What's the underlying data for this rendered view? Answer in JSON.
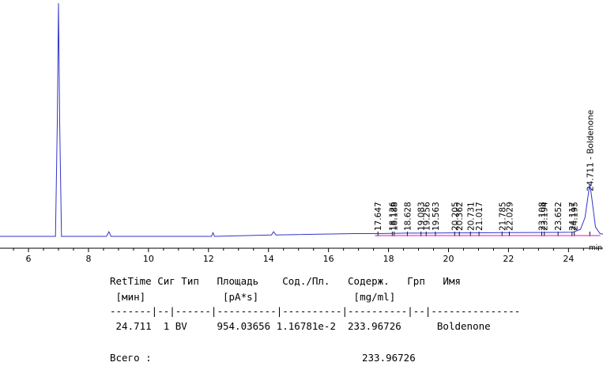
{
  "chart_data": {
    "type": "line",
    "x_unit_label": "min",
    "x_ticks": [
      6,
      8,
      10,
      12,
      14,
      16,
      18,
      20,
      22,
      24
    ],
    "xlim": [
      5.05,
      25.15
    ],
    "ylim": [
      0,
      1000
    ],
    "grid": false,
    "series": [
      {
        "color": "#3333cc",
        "x": [
          5.05,
          6.0,
          6.9,
          6.96,
          7.0,
          7.04,
          7.1,
          8.6,
          8.68,
          8.75,
          10.0,
          12.1,
          12.15,
          12.2,
          14.1,
          14.17,
          14.25,
          16.9,
          17.65,
          18.63,
          19.26,
          20.03,
          20.73,
          21.79,
          22.03,
          23.65,
          24.15,
          24.4,
          24.55,
          24.65,
          24.711,
          24.77,
          24.9,
          25.05,
          25.15
        ],
        "y": [
          0,
          0,
          0,
          490,
          1000,
          490,
          0,
          0,
          20,
          0,
          0,
          0,
          16,
          0,
          6,
          20,
          6,
          12,
          12,
          14,
          14,
          15,
          15,
          16,
          16,
          17,
          18,
          30,
          80,
          170,
          225,
          170,
          40,
          12,
          10
        ]
      }
    ],
    "peak_labels": [
      "17.647",
      "18.126",
      "18.188",
      "18.628",
      "19.083",
      "19.256",
      "19.563",
      "20.205",
      "20.362",
      "20.731",
      "21.017",
      "21.785",
      "22.029",
      "23.108",
      "23.194",
      "23.652",
      "24.117",
      "24.195",
      "24.711 - Boldenone"
    ],
    "peak_times": [
      17.647,
      18.126,
      18.188,
      18.628,
      19.083,
      19.256,
      19.563,
      20.205,
      20.362,
      20.731,
      21.017,
      21.785,
      22.029,
      23.108,
      23.194,
      23.652,
      24.117,
      24.195,
      24.711
    ]
  },
  "report": {
    "header1": "RetTime Сиг Тип   Площадь    Сод./Пл.   Содерж.   Грп   Имя",
    "header2": " [мин]             [pA*s]                [mg/ml]",
    "separator": "-------|--|------|----------|----------|----------|--|---------------",
    "row": " 24.711  1 BV     954.03656 1.16781e-2  233.96726      Boldenone",
    "total_label": "Всего :",
    "total_value": "233.96726"
  }
}
